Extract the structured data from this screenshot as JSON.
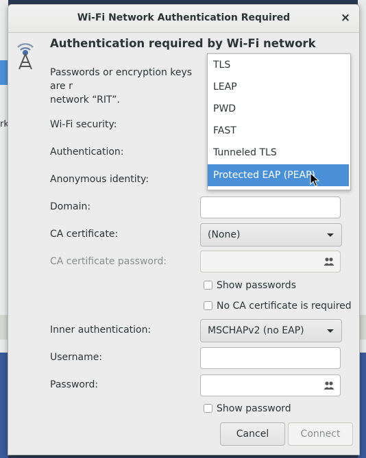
{
  "window": {
    "title": "Wi-Fi Network Authentication Required",
    "close_glyph": "×"
  },
  "background": {
    "left_text": "rk"
  },
  "header": {
    "heading": "Authentication required by Wi-Fi network",
    "description": "Passwords or encryption keys are required to access the Wi-Fi network “RIT”.",
    "description_visible_line1": "Passwords or encryption keys are r",
    "description_visible_line2": "network “RIT”."
  },
  "form": {
    "wifi_security_label": "Wi-Fi security:",
    "authentication_label": "Authentication:",
    "anonymous_identity_label": "Anonymous identity:",
    "domain_label": "Domain:",
    "domain_value": "",
    "ca_certificate_label": "CA certificate:",
    "ca_certificate_value": "(None)",
    "ca_password_label": "CA certificate password:",
    "show_passwords_label": "Show passwords",
    "no_ca_label": "No CA certificate is required",
    "inner_auth_label": "Inner authentication:",
    "inner_auth_value": "MSCHAPv2 (no EAP)",
    "username_label": "Username:",
    "username_value": "",
    "password_label": "Password:",
    "password_value": "",
    "show_password_label": "Show password"
  },
  "popup": {
    "items": [
      "TLS",
      "LEAP",
      "PWD",
      "FAST",
      "Tunneled TLS",
      "Protected EAP (PEAP)"
    ],
    "selected": "Protected EAP (PEAP)"
  },
  "buttons": {
    "cancel": "Cancel",
    "connect": "Connect"
  },
  "colors": {
    "accent": "#4a90d9",
    "dialog_bg": "#ececec"
  },
  "icons": [
    "wifi-tower-icon",
    "close-icon",
    "people-icon",
    "dropdown-arrow-icon",
    "mouse-cursor-icon"
  ]
}
